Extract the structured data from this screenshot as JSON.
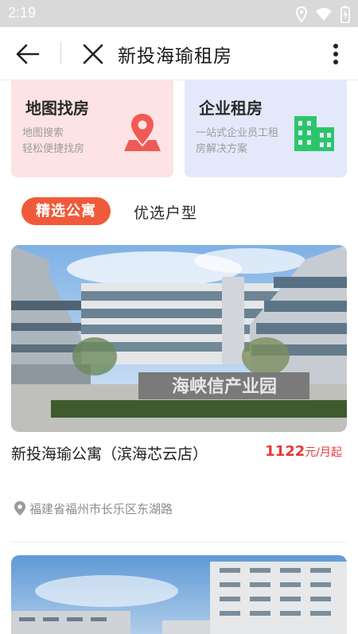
{
  "status": {
    "time": "2:19"
  },
  "nav": {
    "title": "新投海瑜租房"
  },
  "cards": [
    {
      "title": "地图找房",
      "sub1": "地图搜索",
      "sub2": "轻松便捷找房",
      "icon": "map-pin-icon",
      "bg": "#fde3e3",
      "accent": "#f05a55"
    },
    {
      "title": "企业租房",
      "sub1": "一站式企业员工租",
      "sub2": "房解决方案",
      "icon": "building-icon",
      "bg": "#e3e9fb",
      "accent": "#2bc66b"
    }
  ],
  "tabs": [
    {
      "label": "精选公寓",
      "active": true
    },
    {
      "label": "优选户型",
      "active": false
    }
  ],
  "listings": [
    {
      "name": "新投海瑜公寓（滨海芯云店）",
      "price": "1122",
      "price_unit": "元/月起",
      "address": "福建省福州市长乐区东湖路",
      "sign_text": "海峡信产业园"
    }
  ],
  "colors": {
    "accent": "#f05a3a",
    "price": "#e53935"
  }
}
